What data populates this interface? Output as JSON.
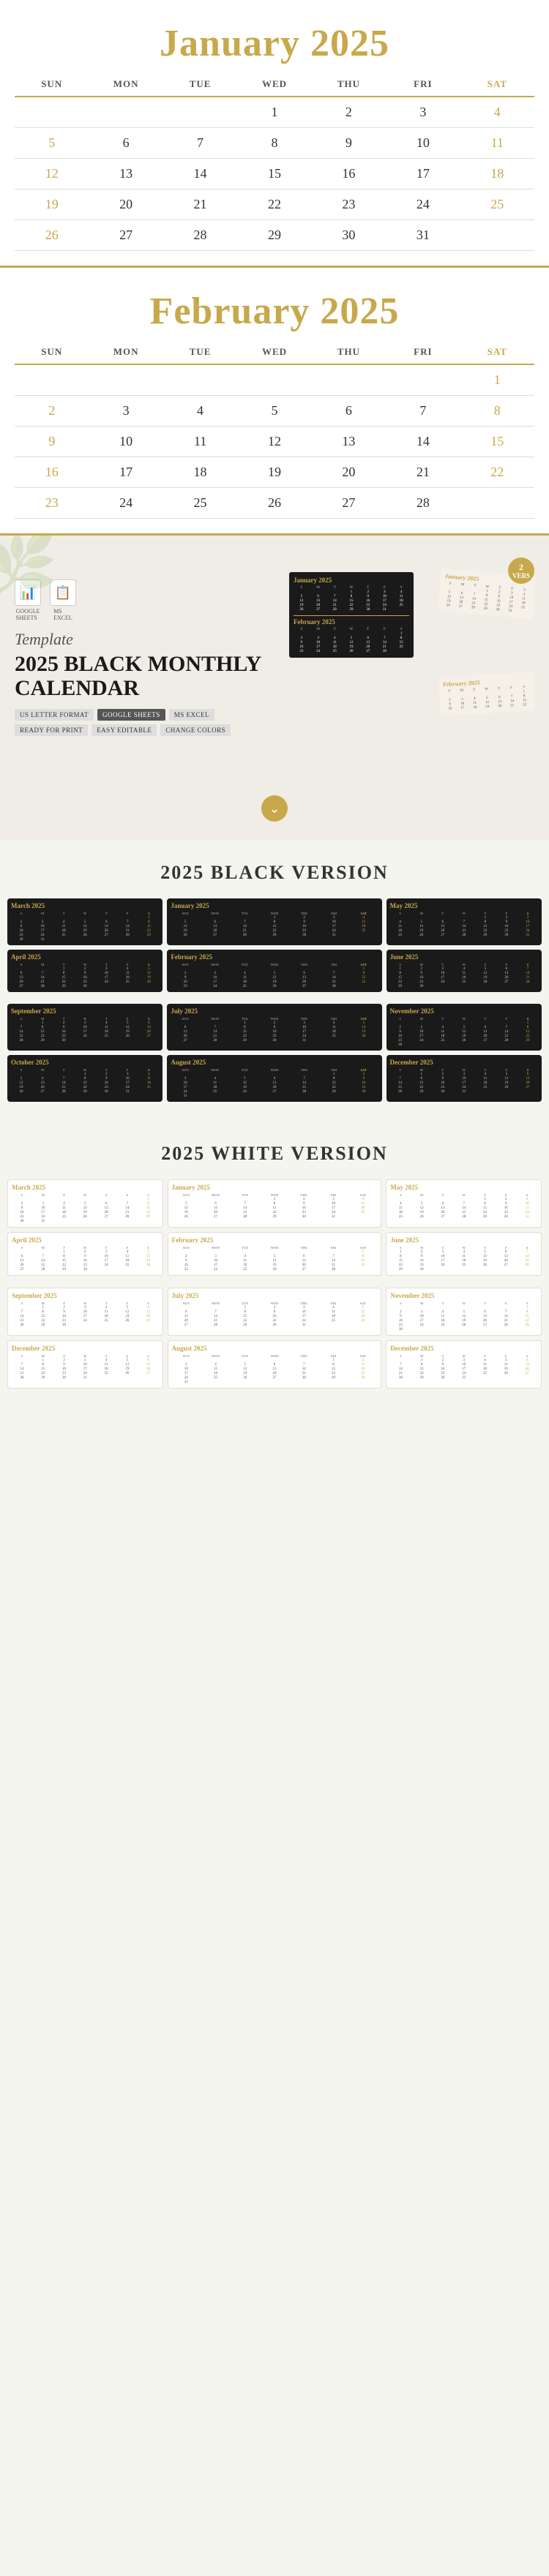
{
  "jan2025": {
    "title": "January 2025",
    "days": [
      "SUN",
      "MON",
      "TUE",
      "WED",
      "THU",
      "FRI",
      "SAT"
    ],
    "weeks": [
      [
        "",
        "",
        "",
        "1",
        "2",
        "3",
        "4"
      ],
      [
        "5",
        "6",
        "7",
        "8",
        "9",
        "10",
        "11"
      ],
      [
        "12",
        "13",
        "14",
        "15",
        "16",
        "17",
        "18"
      ],
      [
        "19",
        "20",
        "21",
        "22",
        "23",
        "24",
        "25"
      ],
      [
        "26",
        "27",
        "28",
        "29",
        "30",
        "31",
        ""
      ]
    ]
  },
  "feb2025": {
    "title": "February 2025",
    "days": [
      "SUN",
      "MON",
      "TUE",
      "WED",
      "THU",
      "FRI",
      "SAT"
    ],
    "weeks": [
      [
        "",
        "",
        "",
        "",
        "",
        "",
        "1"
      ],
      [
        "2",
        "3",
        "4",
        "5",
        "6",
        "7",
        "8"
      ],
      [
        "9",
        "10",
        "11",
        "12",
        "13",
        "14",
        "15"
      ],
      [
        "16",
        "17",
        "18",
        "19",
        "20",
        "21",
        "22"
      ],
      [
        "23",
        "24",
        "25",
        "26",
        "27",
        "28",
        ""
      ]
    ]
  },
  "promo": {
    "template_label": "Template",
    "main_title": "2025 BLACK MONTHLY CALENDAR",
    "icons": [
      {
        "name": "Google Sheets",
        "symbol": "📊"
      },
      {
        "name": "MS Excel",
        "symbol": "📋"
      }
    ],
    "tags": [
      "US LETTER FORMAT",
      "GOOGLE SHEETS",
      "MS EXCEL",
      "READY FOR PRINT",
      "EASY EDITABLE",
      "CHANGE COLORS"
    ],
    "version_badge": "2",
    "version_label": "VERS"
  },
  "black_version_title": "2025 BLACK VERSION",
  "white_version_title": "2025 WHITE VERSION",
  "mini_cals_black": [
    {
      "row": [
        {
          "title": "March 2025",
          "weeks": [
            [
              "",
              "",
              "",
              "",
              "",
              "",
              "1"
            ],
            [
              "2",
              "3",
              "4",
              "5",
              "6",
              "7",
              "8"
            ],
            [
              "9",
              "10",
              "11",
              "12",
              "13",
              "14",
              "15"
            ],
            [
              "16",
              "17",
              "18",
              "19",
              "20",
              "21",
              "22"
            ],
            [
              "23",
              "24",
              "25",
              "26",
              "27",
              "28",
              "29"
            ],
            [
              "30",
              "31",
              "",
              "",
              "",
              "",
              ""
            ]
          ]
        },
        {
          "title": "January 2025",
          "weeks": [
            [
              "",
              "",
              "",
              "1",
              "2",
              "3",
              "4"
            ],
            [
              "5",
              "6",
              "7",
              "8",
              "9",
              "10",
              "11"
            ],
            [
              "12",
              "13",
              "14",
              "15",
              "16",
              "17",
              "18"
            ],
            [
              "19",
              "20",
              "21",
              "22",
              "23",
              "24",
              "25"
            ],
            [
              "26",
              "27",
              "28",
              "29",
              "30",
              "31",
              ""
            ]
          ]
        },
        {
          "title": "May 2025",
          "weeks": [
            [
              "",
              "",
              "",
              "",
              "1",
              "2",
              "3"
            ],
            [
              "4",
              "5",
              "6",
              "7",
              "8",
              "9",
              "10"
            ],
            [
              "11",
              "12",
              "13",
              "14",
              "15",
              "16",
              "17"
            ],
            [
              "18",
              "19",
              "20",
              "21",
              "22",
              "23",
              "24"
            ],
            [
              "25",
              "26",
              "27",
              "28",
              "29",
              "30",
              "31"
            ]
          ]
        }
      ]
    },
    {
      "row": [
        {
          "title": "April 2025",
          "weeks": [
            [
              "",
              "",
              "1",
              "2",
              "3",
              "4",
              "5"
            ],
            [
              "6",
              "7",
              "8",
              "9",
              "10",
              "11",
              "12"
            ],
            [
              "13",
              "14",
              "15",
              "16",
              "17",
              "18",
              "19"
            ],
            [
              "20",
              "21",
              "22",
              "23",
              "24",
              "25",
              "26"
            ],
            [
              "27",
              "28",
              "29",
              "30",
              "",
              "",
              ""
            ]
          ]
        },
        {
          "title": "February 2025",
          "weeks": [
            [
              "",
              "",
              "",
              "",
              "",
              "",
              "1"
            ],
            [
              "2",
              "3",
              "4",
              "5",
              "6",
              "7",
              "8"
            ],
            [
              "9",
              "10",
              "11",
              "12",
              "13",
              "14",
              "15"
            ],
            [
              "16",
              "17",
              "18",
              "19",
              "20",
              "21",
              "22"
            ],
            [
              "23",
              "24",
              "25",
              "26",
              "27",
              "28",
              ""
            ]
          ]
        },
        {
          "title": "June 2025",
          "weeks": [
            [
              "1",
              "2",
              "3",
              "4",
              "5",
              "6",
              "7"
            ],
            [
              "8",
              "9",
              "10",
              "11",
              "12",
              "13",
              "14"
            ],
            [
              "15",
              "16",
              "17",
              "18",
              "19",
              "20",
              "21"
            ],
            [
              "22",
              "23",
              "24",
              "25",
              "26",
              "27",
              "28"
            ],
            [
              "29",
              "30",
              "",
              "",
              "",
              "",
              ""
            ]
          ]
        }
      ]
    }
  ],
  "mini_cals_black2": [
    {
      "row": [
        {
          "title": "September 2025",
          "weeks": [
            [
              "",
              "1",
              "2",
              "3",
              "4",
              "5",
              "6"
            ],
            [
              "7",
              "8",
              "9",
              "10",
              "11",
              "12",
              "13"
            ],
            [
              "14",
              "15",
              "16",
              "17",
              "18",
              "19",
              "20"
            ],
            [
              "21",
              "22",
              "23",
              "24",
              "25",
              "26",
              "27"
            ],
            [
              "28",
              "29",
              "30",
              "",
              "",
              "",
              ""
            ]
          ]
        },
        {
          "title": "July 2025",
          "weeks": [
            [
              "",
              "",
              "1",
              "2",
              "3",
              "4",
              "5"
            ],
            [
              "6",
              "7",
              "8",
              "9",
              "10",
              "11",
              "12"
            ],
            [
              "13",
              "14",
              "15",
              "16",
              "17",
              "18",
              "19"
            ],
            [
              "20",
              "21",
              "22",
              "23",
              "24",
              "25",
              "26"
            ],
            [
              "27",
              "28",
              "29",
              "30",
              "31",
              "",
              ""
            ]
          ]
        },
        {
          "title": "November 2025",
          "weeks": [
            [
              "",
              "",
              "",
              "",
              "",
              "",
              "1"
            ],
            [
              "2",
              "3",
              "4",
              "5",
              "6",
              "7",
              "8"
            ],
            [
              "9",
              "10",
              "11",
              "12",
              "13",
              "14",
              "15"
            ],
            [
              "16",
              "17",
              "18",
              "19",
              "20",
              "21",
              "22"
            ],
            [
              "23",
              "24",
              "25",
              "26",
              "27",
              "28",
              "29"
            ],
            [
              "30",
              "",
              "",
              "",
              "",
              "",
              ""
            ]
          ]
        }
      ]
    },
    {
      "row": [
        {
          "title": "October 2025",
          "weeks": [
            [
              "",
              "",
              "",
              "1",
              "2",
              "3",
              "4"
            ],
            [
              "5",
              "6",
              "7",
              "8",
              "9",
              "10",
              "11"
            ],
            [
              "12",
              "13",
              "14",
              "15",
              "16",
              "17",
              "18"
            ],
            [
              "19",
              "20",
              "21",
              "22",
              "23",
              "24",
              "25"
            ],
            [
              "26",
              "27",
              "28",
              "29",
              "30",
              "31",
              ""
            ]
          ]
        },
        {
          "title": "August 2025",
          "weeks": [
            [
              "",
              "",
              "",
              "",
              "",
              "1",
              "2"
            ],
            [
              "3",
              "4",
              "5",
              "6",
              "7",
              "8",
              "9"
            ],
            [
              "10",
              "11",
              "12",
              "13",
              "14",
              "15",
              "16"
            ],
            [
              "17",
              "18",
              "19",
              "20",
              "21",
              "22",
              "23"
            ],
            [
              "24",
              "25",
              "26",
              "27",
              "28",
              "29",
              "30"
            ],
            [
              "31",
              "",
              "",
              "",
              "",
              "",
              ""
            ]
          ]
        },
        {
          "title": "December 2025",
          "weeks": [
            [
              "",
              "1",
              "2",
              "3",
              "4",
              "5",
              "6"
            ],
            [
              "7",
              "8",
              "9",
              "10",
              "11",
              "12",
              "13"
            ],
            [
              "14",
              "15",
              "16",
              "17",
              "18",
              "19",
              "20"
            ],
            [
              "21",
              "22",
              "23",
              "24",
              "25",
              "26",
              "27"
            ],
            [
              "28",
              "29",
              "30",
              "31",
              "",
              "",
              ""
            ]
          ]
        }
      ]
    }
  ],
  "mini_cals_white": [
    {
      "row": [
        {
          "title": "March 2025"
        },
        {
          "title": "January 2025"
        },
        {
          "title": "May 2025"
        }
      ]
    },
    {
      "row": [
        {
          "title": "April 2025"
        },
        {
          "title": "February 2025"
        },
        {
          "title": "June 2025"
        }
      ]
    }
  ],
  "mini_cals_white2": [
    {
      "row": [
        {
          "title": "September 2025"
        },
        {
          "title": "July 2025"
        },
        {
          "title": "November 2025"
        }
      ]
    },
    {
      "row": [
        {
          "title": "December 2025"
        },
        {
          "title": "August 2025"
        },
        {
          "title": "December 2025"
        }
      ]
    }
  ]
}
